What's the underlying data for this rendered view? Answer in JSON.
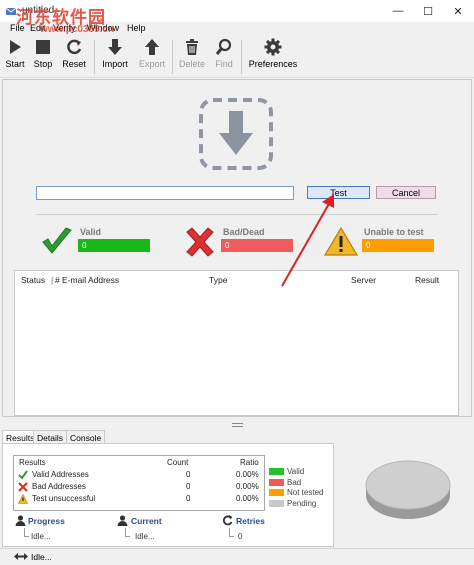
{
  "window": {
    "title": "untitled",
    "watermark": "河东软件园",
    "watermark_url": "www.pc0359.cn",
    "minimize": "—",
    "maximize": "☐",
    "close": "✕"
  },
  "menu": [
    "File",
    "Edit",
    "Verify",
    "Window",
    "Help"
  ],
  "toolbar": {
    "start": "Start",
    "stop": "Stop",
    "reset": "Reset",
    "import": "Import",
    "export": "Export",
    "delete": "Delete",
    "find": "Find",
    "preferences": "Preferences"
  },
  "input": {
    "value": "",
    "placeholder": ""
  },
  "buttons": {
    "test": "Test",
    "cancel": "Cancel"
  },
  "stats": [
    {
      "label": "Valid",
      "value": "0",
      "color": "#18b818"
    },
    {
      "label": "Bad/Dead",
      "value": "0",
      "color": "#f05b5b"
    },
    {
      "label": "Unable to test",
      "value": "0",
      "color": "#ff9c00"
    }
  ],
  "table": {
    "columns": [
      "Status",
      "#",
      "E-mail Address",
      "Type",
      "Server",
      "Result"
    ],
    "rows": []
  },
  "tabs": [
    "Results",
    "Details",
    "Console"
  ],
  "summary": {
    "header": {
      "name": "Results",
      "count": "Count",
      "ratio": "Ratio"
    },
    "rows": [
      {
        "name": "Valid Addresses",
        "count": "0",
        "ratio": "0.00%"
      },
      {
        "name": "Bad Addresses",
        "count": "0",
        "ratio": "0.00%"
      },
      {
        "name": "Test unsuccessful",
        "count": "0",
        "ratio": "0.00%"
      }
    ]
  },
  "legend": [
    {
      "label": "Valid",
      "color": "#26c126"
    },
    {
      "label": "Bad",
      "color": "#ef5a5a"
    },
    {
      "label": "Not tested",
      "color": "#ff9c00"
    },
    {
      "label": "Pending",
      "color": "#c8c8c8"
    }
  ],
  "progress": {
    "progress": {
      "label": "Progress",
      "value": "Idle..."
    },
    "current": {
      "label": "Current",
      "value": "Idle..."
    },
    "retries": {
      "label": "Retries",
      "value": "0"
    }
  },
  "status": {
    "text": "Idle..."
  }
}
